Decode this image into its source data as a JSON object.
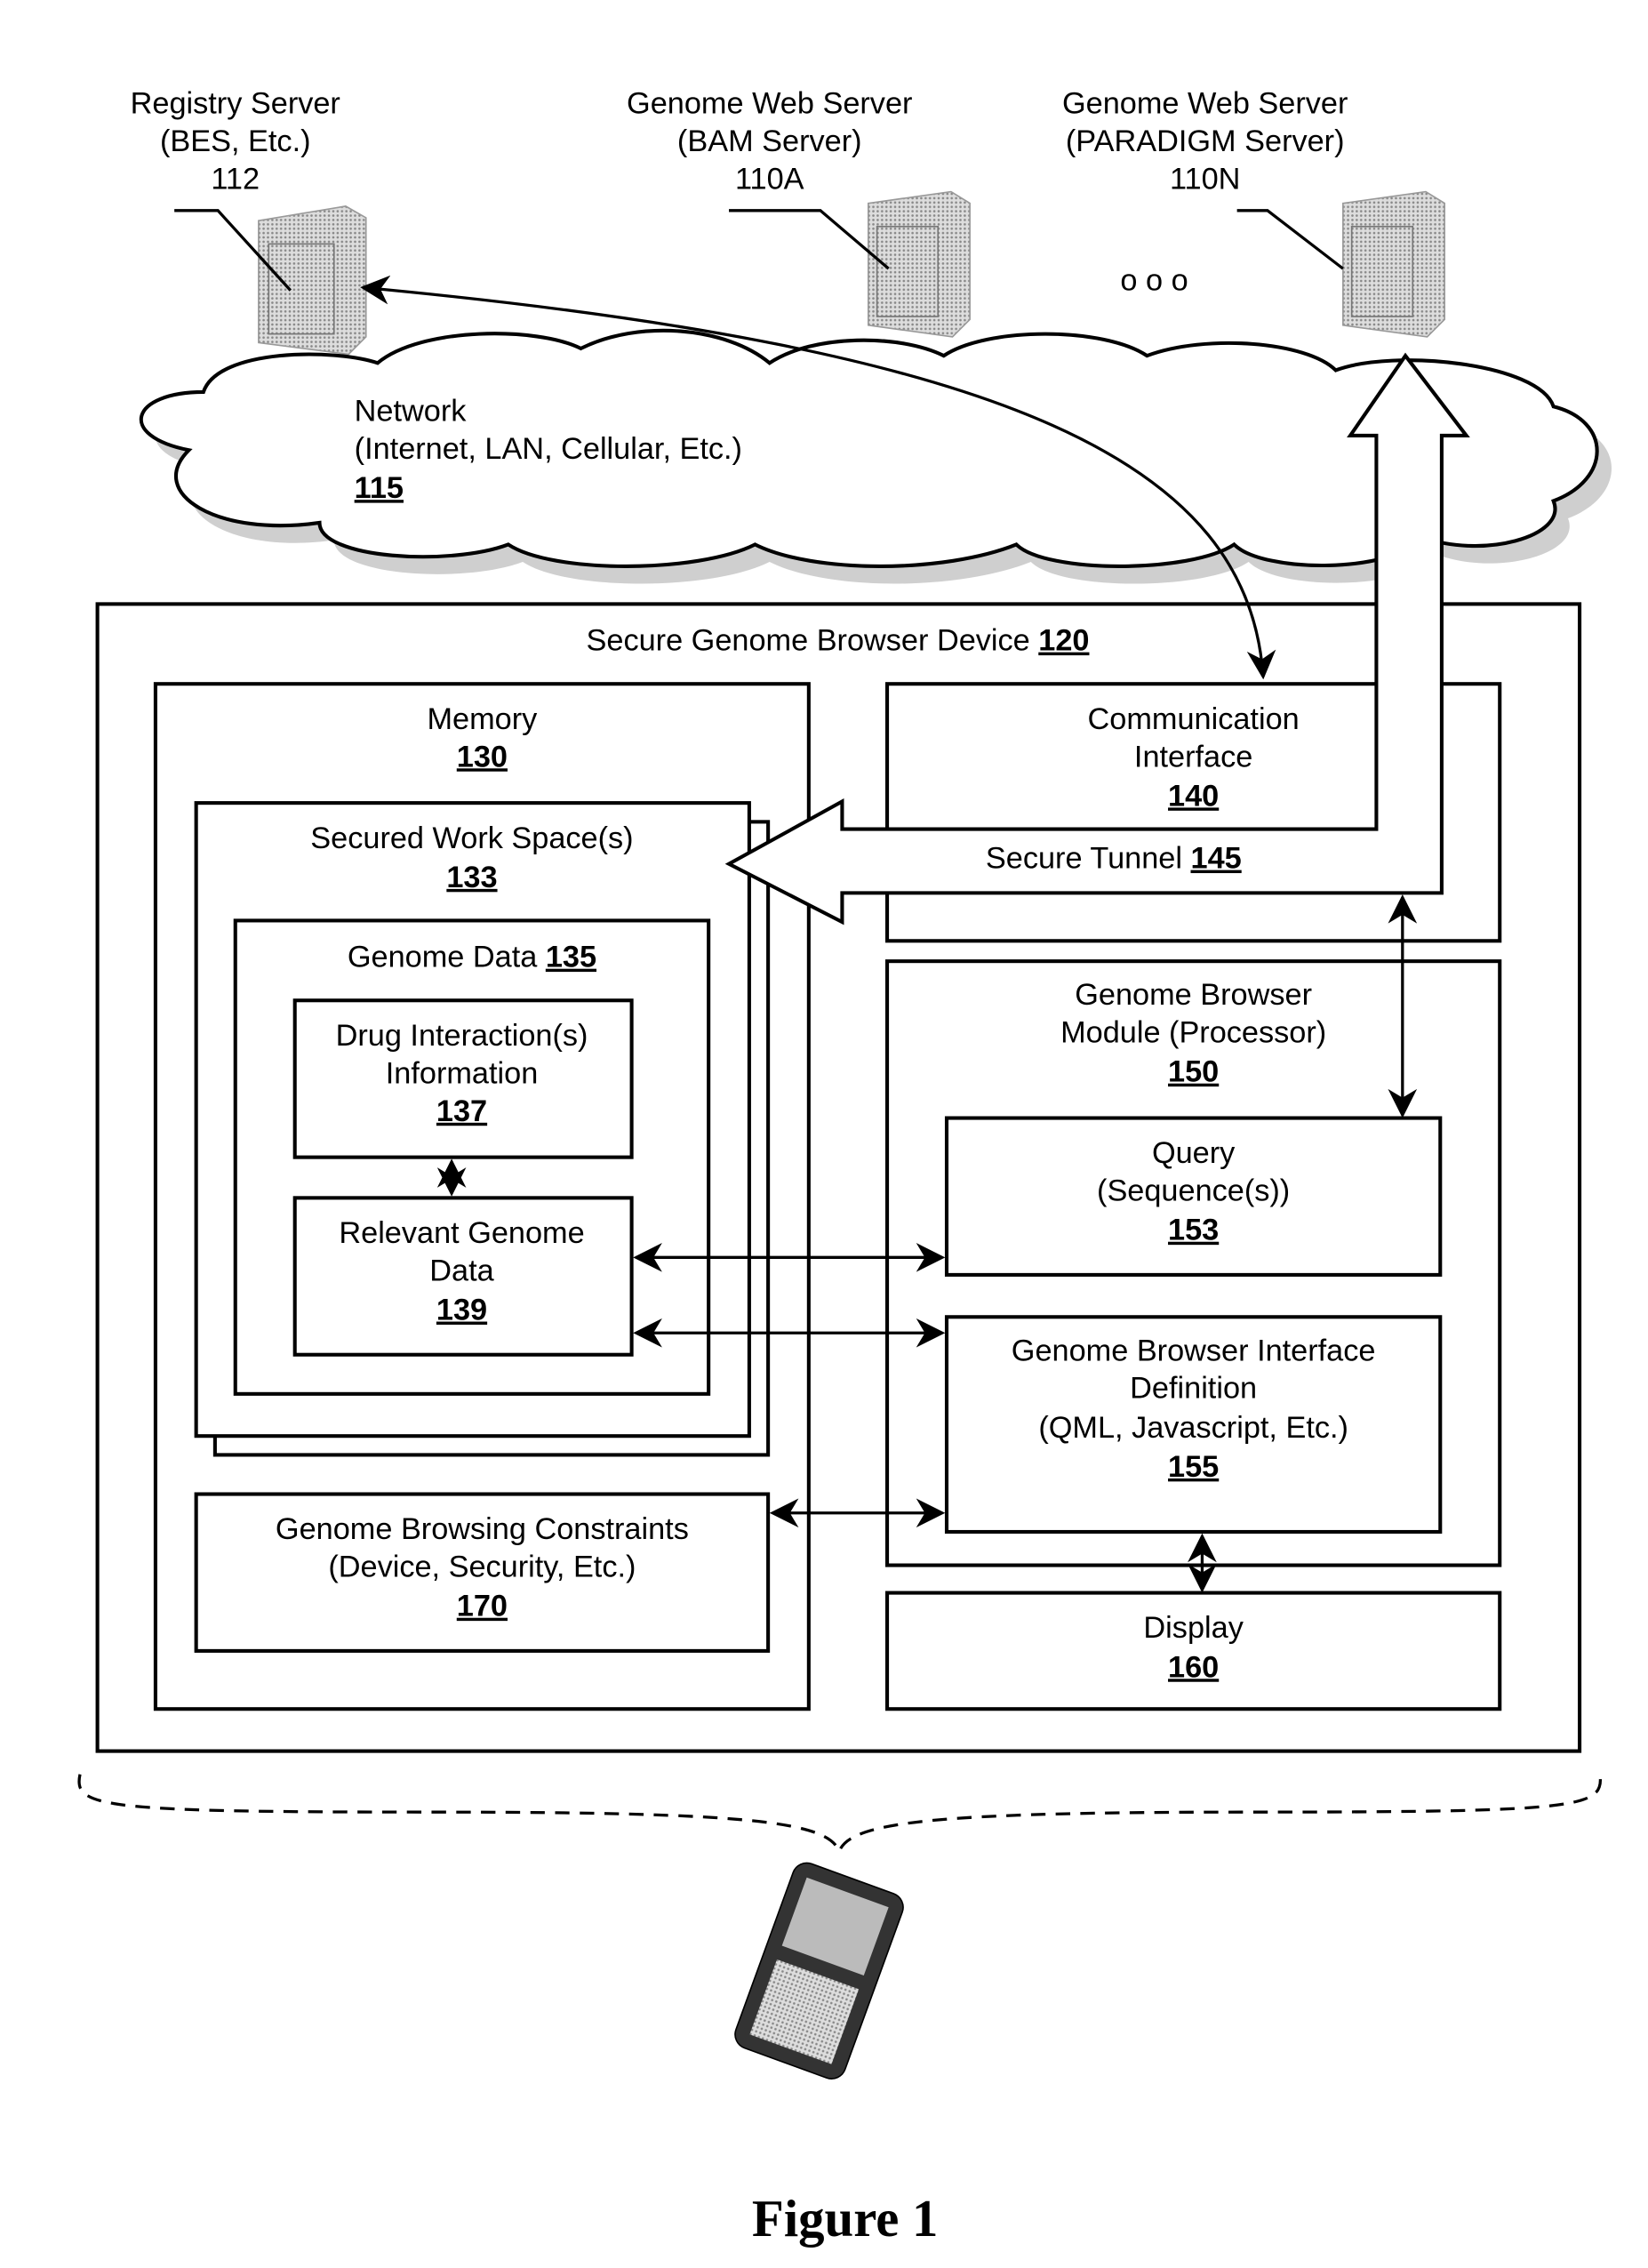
{
  "servers": [
    {
      "name": "Registry Server",
      "sub": "(BES, Etc.)",
      "ref": "112"
    },
    {
      "name": "Genome Web Server",
      "sub": "(BAM Server)",
      "ref": "110A"
    },
    {
      "name": "Genome Web Server",
      "sub": "(PARADIGM Server)",
      "ref": "110N"
    }
  ],
  "ellipsis": "o o o",
  "network": {
    "name": "Network",
    "sub": "(Internet, LAN, Cellular, Etc.)",
    "ref": "115"
  },
  "device": {
    "name": "Secure Genome Browser Device",
    "ref": "120"
  },
  "memory": {
    "name": "Memory",
    "ref": "130"
  },
  "workspace": {
    "name": "Secured Work Space(s)",
    "ref": "133"
  },
  "genome_data": {
    "name": "Genome Data",
    "ref": "135"
  },
  "drug_info": {
    "line1": "Drug Interaction(s)",
    "line2": "Information",
    "ref": "137"
  },
  "relevant": {
    "line1": "Relevant Genome",
    "line2": "Data",
    "ref": "139"
  },
  "constraints": {
    "line1": "Genome Browsing Constraints",
    "line2": "(Device, Security, Etc.)",
    "ref": "170"
  },
  "comm": {
    "line1": "Communication",
    "line2": "Interface",
    "ref": "140"
  },
  "tunnel": {
    "name": "Secure Tunnel",
    "ref": "145"
  },
  "module": {
    "line1": "Genome Browser",
    "line2": "Module (Processor)",
    "ref": "150"
  },
  "query": {
    "line1": "Query",
    "line2": "(Sequence(s))",
    "ref": "153"
  },
  "gbid": {
    "line1": "Genome Browser Interface",
    "line2": "Definition",
    "line3": "(QML, Javascript, Etc.)",
    "ref": "155"
  },
  "display": {
    "name": "Display",
    "ref": "160"
  },
  "figure_label": "Figure 1"
}
